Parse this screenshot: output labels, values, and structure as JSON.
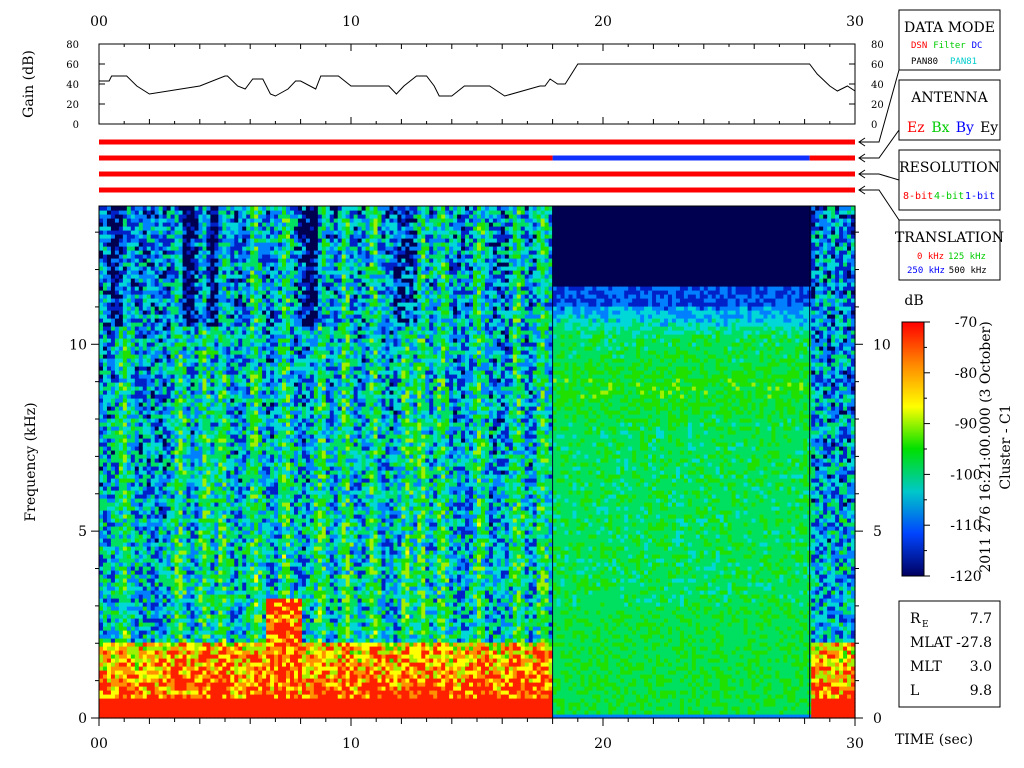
{
  "chart_data": [
    {
      "type": "line",
      "ylabel": "Gain (dB)",
      "xlim": [
        0,
        30
      ],
      "ylim": [
        0,
        80
      ],
      "x_ticks": [
        "00",
        "10",
        "20",
        "30"
      ],
      "y_ticks": [
        "0",
        "20",
        "40",
        "60",
        "80"
      ],
      "series": [
        {
          "x": [
            0,
            0.4,
            0.5,
            1.1,
            1.5,
            2,
            4,
            5,
            5.1,
            5.5,
            5.8,
            6.1,
            6.5,
            6.8,
            7,
            7.5,
            7.8,
            8,
            8.6,
            8.8,
            9.5,
            10,
            10.5,
            11.1,
            11.5,
            11.8,
            12.1,
            12.6,
            13,
            13.3,
            13.5,
            14,
            14.5,
            15,
            15.5,
            16.1,
            17.5,
            17.7,
            17.9,
            18.2,
            18.5,
            19,
            28,
            28.2,
            28.5,
            29,
            29.3,
            29.7,
            30
          ],
          "y": [
            43,
            43,
            48,
            48,
            38,
            30,
            38,
            48,
            48,
            38,
            35,
            45,
            45,
            30,
            28,
            35,
            43,
            43,
            35,
            48,
            48,
            38,
            38,
            38,
            38,
            30,
            38,
            48,
            48,
            38,
            28,
            28,
            38,
            38,
            38,
            28,
            38,
            38,
            45,
            40,
            40,
            60,
            60,
            60,
            50,
            38,
            33,
            38,
            33
          ]
        }
      ]
    },
    {
      "type": "heatmap",
      "title": "",
      "xlabel": "TIME (sec)",
      "ylabel": "Frequency (kHz)",
      "xlim": [
        0,
        30
      ],
      "ylim": [
        0,
        13.7
      ],
      "x_ticks": [
        "00",
        "10",
        "20",
        "30"
      ],
      "y_ticks": [
        "0",
        "5",
        "10"
      ],
      "colorbar": {
        "label": "dB",
        "range": [
          -120,
          -70
        ],
        "ticks": [
          "-70",
          "-80",
          "-90",
          "-100",
          "-110",
          "-120"
        ],
        "colors": [
          "#ff0000",
          "#ff8800",
          "#ffff00",
          "#00e000",
          "#00c8c8",
          "#0044ff",
          "#000060"
        ]
      },
      "segments": [
        {
          "x": [
            0,
            18.0
          ],
          "mode": "broadband noise with strong low-frequency (<2 kHz) red emission and vertical bursts"
        },
        {
          "x": [
            18.0,
            28.2
          ],
          "mode": "flat green spectrum, dark blue above ~11.5 kHz"
        },
        {
          "x": [
            28.2,
            30
          ],
          "mode": "broadband noise with low-frequency red emission"
        }
      ]
    },
    {
      "type": "bar",
      "xlim": [
        0,
        30
      ],
      "categories": [
        "DATA MODE",
        "ANTENNA",
        "RESOLUTION",
        "TRANSLATION"
      ],
      "bars": [
        {
          "segments": [
            {
              "x": [
                0,
                30
              ],
              "color": "#ff0000"
            }
          ]
        },
        {
          "segments": [
            {
              "x": [
                0,
                18.0
              ],
              "color": "#ff0000"
            },
            {
              "x": [
                18.0,
                28.2
              ],
              "color": "#1030ff"
            },
            {
              "x": [
                28.2,
                30
              ],
              "color": "#ff0000"
            }
          ]
        },
        {
          "segments": [
            {
              "x": [
                0,
                30
              ],
              "color": "#ff0000"
            }
          ]
        },
        {
          "segments": [
            {
              "x": [
                0,
                30
              ],
              "color": "#ff0000"
            }
          ]
        }
      ]
    }
  ],
  "legends": {
    "data_mode": {
      "title": "DATA MODE",
      "row1": [
        {
          "text": "DSN",
          "color": "#ff0000"
        },
        {
          "text": "Filter",
          "color": "#00cc00"
        },
        {
          "text": "DC",
          "color": "#0000ff"
        }
      ],
      "row2": [
        {
          "text": "PAN80",
          "color": "#000000"
        },
        {
          "text": "PAN81",
          "color": "#00cccc"
        }
      ]
    },
    "antenna": {
      "title": "ANTENNA",
      "items": [
        {
          "text": "Ez",
          "color": "#ff0000"
        },
        {
          "text": "Bx",
          "color": "#00cc00"
        },
        {
          "text": "By",
          "color": "#0000ff"
        },
        {
          "text": "Ey",
          "color": "#000000"
        }
      ]
    },
    "resolution": {
      "title": "RESOLUTION",
      "items": [
        {
          "text": "8-bit",
          "color": "#ff0000"
        },
        {
          "text": "4-bit",
          "color": "#00cc00"
        },
        {
          "text": "1-bit",
          "color": "#0000ff"
        }
      ]
    },
    "translation": {
      "title": "TRANSLATION",
      "row1": [
        {
          "text": "0 kHz",
          "color": "#ff0000"
        },
        {
          "text": "125 kHz",
          "color": "#00cc00"
        }
      ],
      "row2": [
        {
          "text": "250 kHz",
          "color": "#0000ff"
        },
        {
          "text": "500 kHz",
          "color": "#000000"
        }
      ]
    }
  },
  "timestamp": "2011 276 16:21:00.000 (3 October)",
  "spacecraft": "Cluster - C1",
  "orbit": [
    {
      "label": "R",
      "sub": "E",
      "value": "7.7"
    },
    {
      "label": "MLAT",
      "sub": "",
      "value": "-27.8"
    },
    {
      "label": "MLT",
      "sub": "",
      "value": "3.0"
    },
    {
      "label": "L",
      "sub": "",
      "value": "9.8"
    }
  ]
}
